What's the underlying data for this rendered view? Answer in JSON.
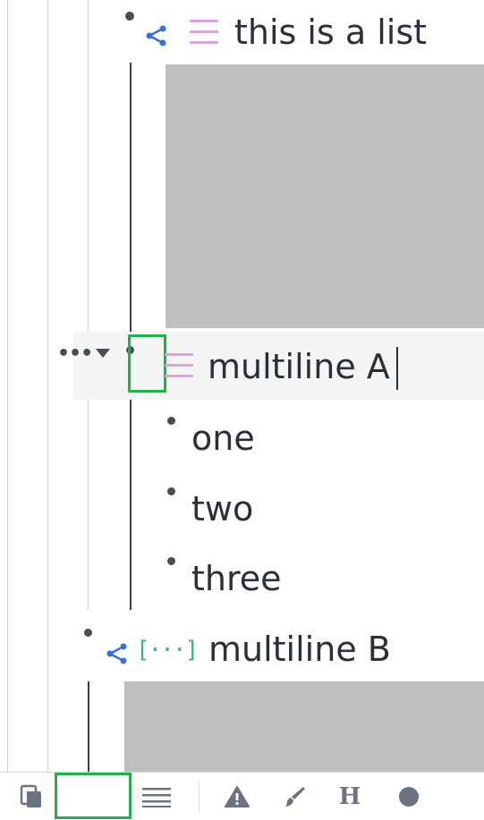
{
  "nodes": {
    "list_node": {
      "label": "this is a list"
    },
    "multiline_a": {
      "label": "multiline A"
    },
    "children": [
      {
        "label": "one"
      },
      {
        "label": "two"
      },
      {
        "label": "three"
      }
    ],
    "multiline_b": {
      "label": "multiline B",
      "icon_glyph": "[···]"
    }
  },
  "controls": {
    "more_glyph": "•••"
  },
  "toolbar": {
    "heading_glyph": "H"
  },
  "colors": {
    "list_icon": "#dba4de",
    "share_icon": "#3b6fd4",
    "bracket_icon": "#3fb47f",
    "focus_box": "#23b04a",
    "placeholder_block": "#bfbfbf",
    "toolbar_icon": "#6c7380"
  },
  "icons": [
    "share-icon",
    "list-icon",
    "bracket-icon",
    "pages-icon",
    "lines-icon",
    "warning-icon",
    "brush-icon",
    "heading-icon",
    "circle-icon"
  ]
}
